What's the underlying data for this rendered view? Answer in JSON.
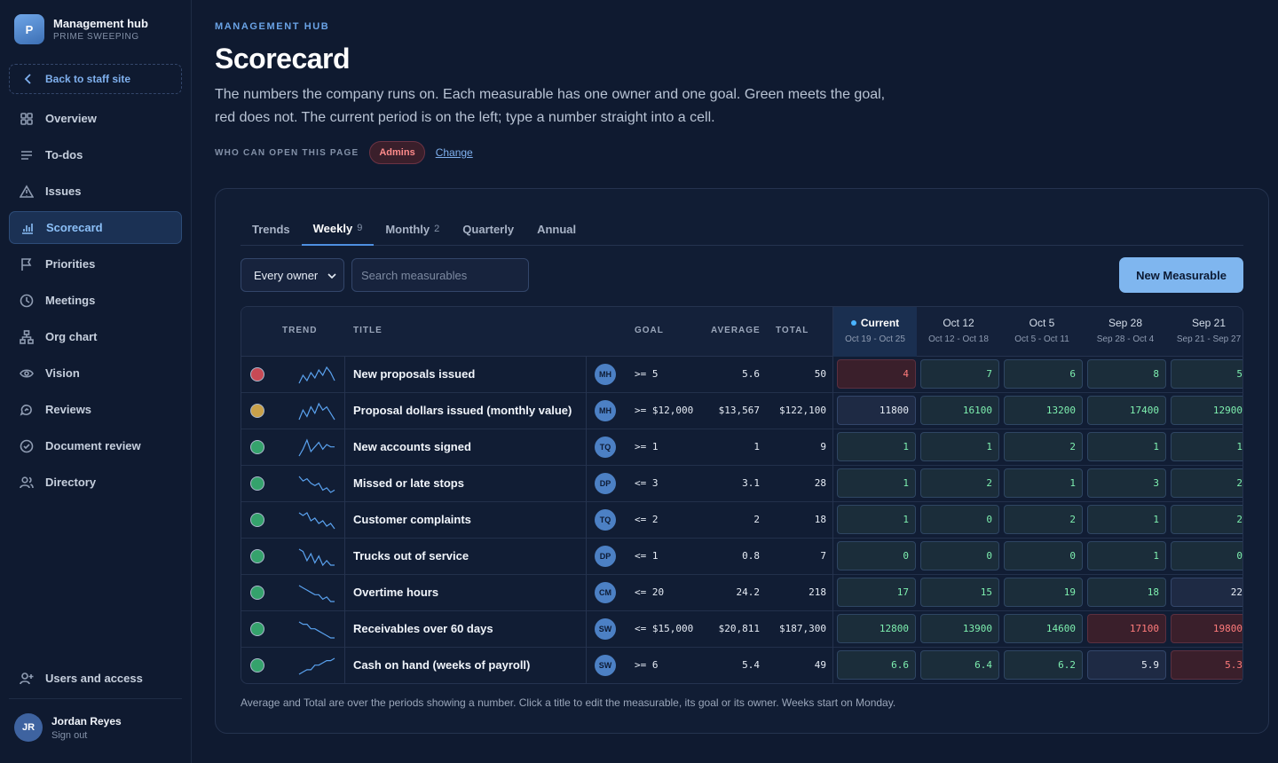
{
  "brand": {
    "initial": "P",
    "title": "Management hub",
    "subtitle": "PRIME SWEEPING"
  },
  "back_label": "Back to staff site",
  "nav": [
    {
      "label": "Overview",
      "icon": "grid-icon",
      "active": false
    },
    {
      "label": "To-dos",
      "icon": "list-icon",
      "active": false
    },
    {
      "label": "Issues",
      "icon": "warning-icon",
      "active": false
    },
    {
      "label": "Scorecard",
      "icon": "bar-chart-icon",
      "active": true
    },
    {
      "label": "Priorities",
      "icon": "flag-icon",
      "active": false
    },
    {
      "label": "Meetings",
      "icon": "clock-icon",
      "active": false
    },
    {
      "label": "Org chart",
      "icon": "org-chart-icon",
      "active": false
    },
    {
      "label": "Vision",
      "icon": "eye-icon",
      "active": false
    },
    {
      "label": "Reviews",
      "icon": "chat-icon",
      "active": false
    },
    {
      "label": "Document review",
      "icon": "check-circle-icon",
      "active": false
    },
    {
      "label": "Directory",
      "icon": "people-icon",
      "active": false
    }
  ],
  "bottom_nav": {
    "label": "Users and access",
    "icon": "add-user-icon"
  },
  "user": {
    "initials": "JR",
    "name": "Jordan Reyes",
    "action": "Sign out"
  },
  "page": {
    "eyebrow": "MANAGEMENT HUB",
    "title": "Scorecard",
    "description": "The numbers the company runs on. Each measurable has one owner and one goal. Green meets the goal, red does not. The current period is on the left; type a number straight into a cell.",
    "access_label": "WHO CAN OPEN THIS PAGE",
    "access_badge": "Admins",
    "change_label": "Change"
  },
  "tabs": [
    {
      "label": "Trends",
      "count": "",
      "active": false
    },
    {
      "label": "Weekly",
      "count": "9",
      "active": true
    },
    {
      "label": "Monthly",
      "count": "2",
      "active": false
    },
    {
      "label": "Quarterly",
      "count": "",
      "active": false
    },
    {
      "label": "Annual",
      "count": "",
      "active": false
    }
  ],
  "filters": {
    "owner_select": "Every owner",
    "search_placeholder": "Search measurables"
  },
  "new_button": "New Measurable",
  "table": {
    "headers": {
      "trend": "TREND",
      "title": "TITLE",
      "goal": "GOAL",
      "average": "AVERAGE",
      "total": "TOTAL"
    },
    "periods": [
      {
        "label": "Current",
        "range": "Oct 19 - Oct 25",
        "current": true
      },
      {
        "label": "Oct 12",
        "range": "Oct 12 - Oct 18",
        "current": false
      },
      {
        "label": "Oct 5",
        "range": "Oct 5 - Oct 11",
        "current": false
      },
      {
        "label": "Sep 28",
        "range": "Sep 28 - Oct 4",
        "current": false
      },
      {
        "label": "Sep 21",
        "range": "Sep 21 - Sep 27",
        "current": false
      }
    ],
    "rows": [
      {
        "status": "red",
        "title": "New proposals issued",
        "owner": "MH",
        "goal": ">= 5",
        "average": "5.6",
        "total": "50",
        "trend": [
          3,
          6,
          4,
          7,
          5,
          8,
          6,
          9,
          7,
          4
        ],
        "cells": [
          [
            "4",
            "bad"
          ],
          [
            "7",
            "good"
          ],
          [
            "6",
            "good"
          ],
          [
            "8",
            "good"
          ],
          [
            "5",
            "good"
          ]
        ]
      },
      {
        "status": "amber",
        "title": "Proposal dollars issued (monthly value)",
        "owner": "MH",
        "goal": ">= $12,000",
        "average": "$13,567",
        "total": "$122,100",
        "trend": [
          4,
          7,
          5,
          8,
          6,
          9,
          7,
          8,
          6,
          4
        ],
        "cells": [
          [
            "11800",
            "neutral"
          ],
          [
            "16100",
            "good"
          ],
          [
            "13200",
            "good"
          ],
          [
            "17400",
            "good"
          ],
          [
            "12900",
            "good"
          ]
        ]
      },
      {
        "status": "green",
        "title": "New accounts signed",
        "owner": "TQ",
        "goal": ">= 1",
        "average": "1",
        "total": "9",
        "trend": [
          2,
          5,
          9,
          4,
          6,
          8,
          5,
          7,
          6,
          6
        ],
        "cells": [
          [
            "1",
            "good"
          ],
          [
            "1",
            "good"
          ],
          [
            "2",
            "good"
          ],
          [
            "1",
            "good"
          ],
          [
            "1",
            "good"
          ]
        ]
      },
      {
        "status": "green",
        "title": "Missed or late stops",
        "owner": "DP",
        "goal": "<= 3",
        "average": "3.1",
        "total": "28",
        "trend": [
          9,
          7,
          8,
          6,
          5,
          6,
          3,
          4,
          2,
          3
        ],
        "cells": [
          [
            "1",
            "good"
          ],
          [
            "2",
            "good"
          ],
          [
            "1",
            "good"
          ],
          [
            "3",
            "good"
          ],
          [
            "2",
            "good"
          ]
        ]
      },
      {
        "status": "green",
        "title": "Customer complaints",
        "owner": "TQ",
        "goal": "<= 2",
        "average": "2",
        "total": "18",
        "trend": [
          8,
          7,
          8,
          5,
          6,
          4,
          5,
          3,
          4,
          2
        ],
        "cells": [
          [
            "1",
            "good"
          ],
          [
            "0",
            "good"
          ],
          [
            "2",
            "good"
          ],
          [
            "1",
            "good"
          ],
          [
            "2",
            "good"
          ]
        ]
      },
      {
        "status": "green",
        "title": "Trucks out of service",
        "owner": "DP",
        "goal": "<= 1",
        "average": "0.8",
        "total": "7",
        "trend": [
          9,
          8,
          4,
          7,
          3,
          6,
          2,
          4,
          2,
          2
        ],
        "cells": [
          [
            "0",
            "good"
          ],
          [
            "0",
            "good"
          ],
          [
            "0",
            "good"
          ],
          [
            "1",
            "good"
          ],
          [
            "0",
            "good"
          ]
        ]
      },
      {
        "status": "green",
        "title": "Overtime hours",
        "owner": "CM",
        "goal": "<= 20",
        "average": "24.2",
        "total": "218",
        "trend": [
          9,
          8,
          7,
          6,
          5,
          5,
          3,
          4,
          2,
          2
        ],
        "cells": [
          [
            "17",
            "good"
          ],
          [
            "15",
            "good"
          ],
          [
            "19",
            "good"
          ],
          [
            "18",
            "good"
          ],
          [
            "22",
            "neutral"
          ]
        ]
      },
      {
        "status": "green",
        "title": "Receivables over 60 days",
        "owner": "SW",
        "goal": "<= $15,000",
        "average": "$20,811",
        "total": "$187,300",
        "trend": [
          9,
          8,
          8,
          6,
          6,
          5,
          4,
          3,
          2,
          2
        ],
        "cells": [
          [
            "12800",
            "good"
          ],
          [
            "13900",
            "good"
          ],
          [
            "14600",
            "good"
          ],
          [
            "17100",
            "bad"
          ],
          [
            "19800",
            "bad"
          ]
        ]
      },
      {
        "status": "green",
        "title": "Cash on hand (weeks of payroll)",
        "owner": "SW",
        "goal": ">= 6",
        "average": "5.4",
        "total": "49",
        "trend": [
          1,
          2,
          3,
          3,
          5,
          5,
          6,
          7,
          7,
          8
        ],
        "cells": [
          [
            "6.6",
            "good"
          ],
          [
            "6.4",
            "good"
          ],
          [
            "6.2",
            "good"
          ],
          [
            "5.9",
            "neutral"
          ],
          [
            "5.3",
            "bad"
          ]
        ]
      }
    ]
  },
  "footnote": "Average and Total are over the periods showing a number. Click a title to edit the measurable, its goal or its owner. Weeks start on Monday.",
  "colors": {
    "status_red": "#c74a55",
    "status_amber": "#c9a14a",
    "status_green": "#35a26c",
    "accent": "#7fb6ef"
  }
}
